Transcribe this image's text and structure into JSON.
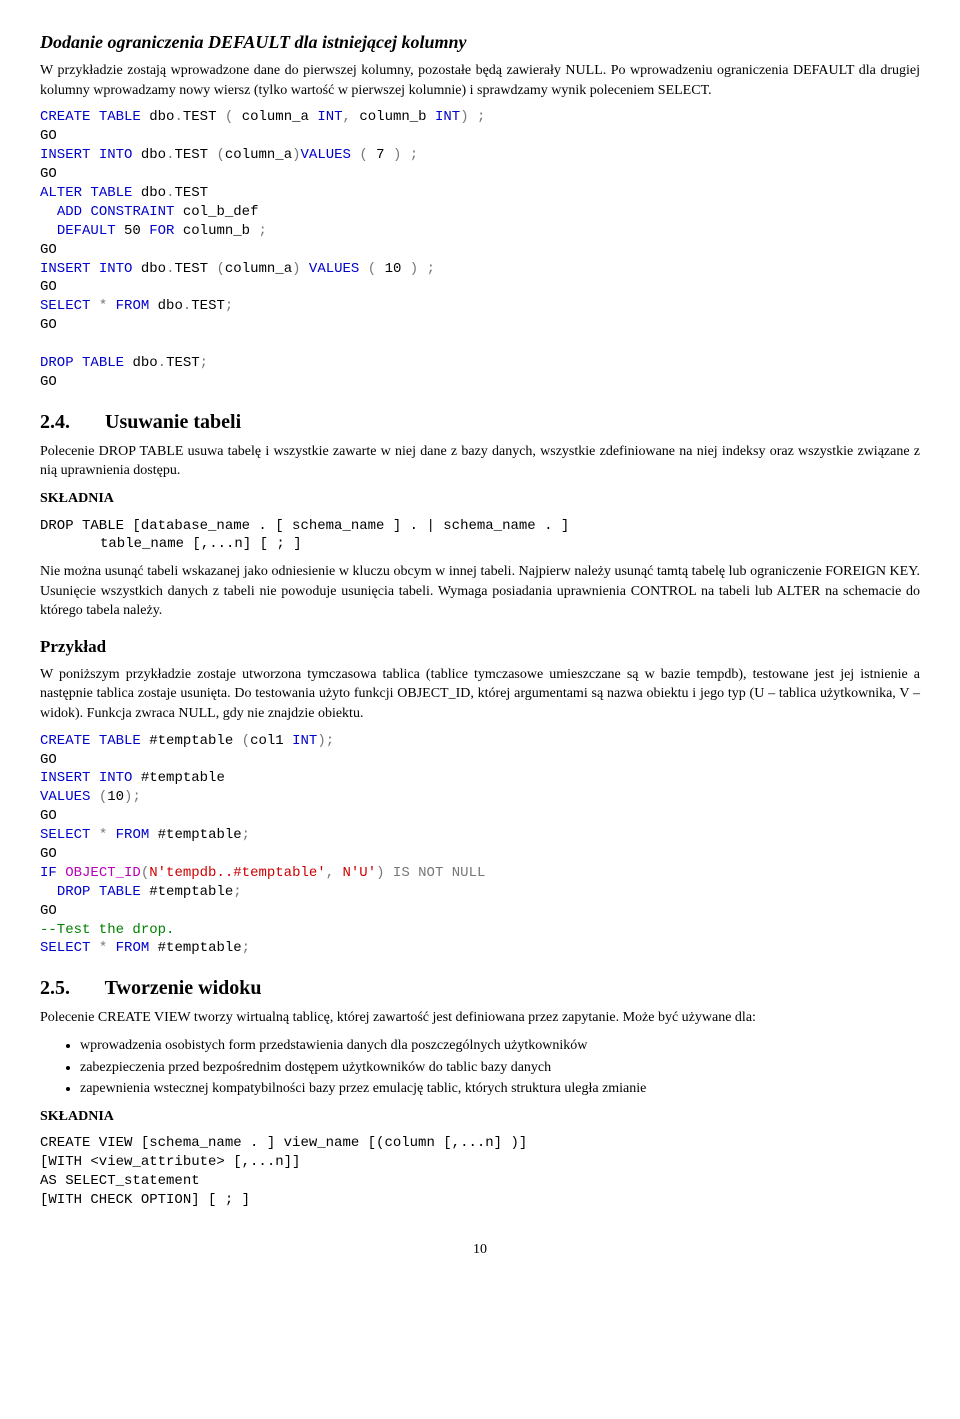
{
  "sec_default": {
    "title": "Dodanie ograniczenia DEFAULT dla istniejącej kolumny",
    "p1": "W przykładzie zostają wprowadzone dane do pierwszej kolumny, pozostałe będą zawierały NULL. Po wprowadzeniu ograniczenia DEFAULT dla drugiej kolumny wprowadzamy nowy wiersz (tylko wartość w pierwszej kolumnie) i sprawdzamy wynik poleceniem SELECT."
  },
  "code1": {
    "l1a": "CREATE",
    "l1b": "TABLE",
    "l1c": "dbo",
    "l1d": ".",
    "l1e": "TEST",
    "l1f": "(",
    "l1g": "column_a",
    "l1h": "INT",
    "l1i": ",",
    "l1j": "column_b",
    "l1k": "INT",
    "l1l": ")",
    "l1m": ";",
    "go": "GO",
    "l2a": "INSERT",
    "l2b": "INTO",
    "l2c": "dbo",
    "l2d": ".",
    "l2e": "TEST",
    "l2f": "(",
    "l2g": "column_a",
    "l2h": ")",
    "l2i": "VALUES",
    "l2j": "(",
    "l2k": "7",
    "l2l": ")",
    "l2m": ";",
    "l3a": "ALTER",
    "l3b": "TABLE",
    "l3c": "dbo",
    "l3d": ".",
    "l3e": "TEST",
    "l4a": "ADD",
    "l4b": "CONSTRAINT",
    "l4c": "col_b_def",
    "l5a": "DEFAULT",
    "l5b": "50",
    "l5c": "FOR",
    "l5d": "column_b",
    "l5e": ";",
    "l6a": "INSERT",
    "l6b": "INTO",
    "l6c": "dbo",
    "l6d": ".",
    "l6e": "TEST",
    "l6f": "(",
    "l6g": "column_a",
    "l6h": ")",
    "l6i": "VALUES",
    "l6j": "(",
    "l6k": "10",
    "l6l": ")",
    "l6m": ";",
    "l7a": "SELECT",
    "l7b": "*",
    "l7c": "FROM",
    "l7d": "dbo",
    "l7e": ".",
    "l7f": "TEST",
    "l7g": ";",
    "l8a": "DROP",
    "l8b": "TABLE",
    "l8c": "dbo",
    "l8d": ".",
    "l8e": "TEST",
    "l8f": ";"
  },
  "sec_24": {
    "num": "2.4.",
    "title": "Usuwanie tabeli",
    "p1": "Polecenie DROP TABLE usuwa tabelę i wszystkie zawarte w niej dane z bazy danych, wszystkie zdefiniowane na niej indeksy oraz wszystkie związane z nią uprawnienia dostępu.",
    "skladnia": "SKŁADNIA",
    "syntax_l1": "DROP TABLE [database_name . [ schema_name ] . | schema_name . ]",
    "syntax_l2": "table_name [,...n] [ ; ]",
    "p2": "Nie można usunąć tabeli wskazanej jako odniesienie w kluczu obcym w innej tabeli. Najpierw należy usunąć tamtą tabelę lub ograniczenie FOREIGN KEY. Usunięcie wszystkich danych z tabeli nie powoduje usunięcia tabeli. Wymaga posiadania uprawnienia CONTROL na tabeli lub ALTER na schemacie do którego tabela należy."
  },
  "przyklad": {
    "title": "Przykład",
    "p1": "W poniższym przykładzie zostaje utworzona tymczasowa tablica (tablice tymczasowe umieszczane są w bazie tempdb), testowane jest jej istnienie a następnie tablica zostaje usunięta. Do testowania użyto funkcji OBJECT_ID, której argumentami są nazwa obiektu i jego typ (U – tablica użytkownika, V – widok). Funkcja zwraca NULL, gdy nie znajdzie obiektu."
  },
  "code2": {
    "l1a": "CREATE",
    "l1b": "TABLE",
    "l1c": "#temptable",
    "l1d": "(",
    "l1e": "col1",
    "l1f": "INT",
    "l1g": ");",
    "go": "GO",
    "l2a": "INSERT",
    "l2b": "INTO",
    "l2c": "#temptable",
    "l3a": "VALUES",
    "l3b": "(",
    "l3c": "10",
    "l3d": ");",
    "l4a": "SELECT",
    "l4b": "*",
    "l4c": "FROM",
    "l4d": "#temptable",
    "l4e": ";",
    "l5a": "IF",
    "l5b": "OBJECT_ID",
    "l5c": "(",
    "l5d": "N'tempdb..#temptable'",
    "l5e": ",",
    "l5f": "N'U'",
    "l5g": ")",
    "l5h": "IS",
    "l5i": "NOT",
    "l5j": "NULL",
    "l6a": "DROP",
    "l6b": "TABLE",
    "l6c": "#temptable",
    "l6d": ";",
    "l7a": "--Test the drop.",
    "l8a": "SELECT",
    "l8b": "*",
    "l8c": "FROM",
    "l8d": "#temptable",
    "l8e": ";"
  },
  "sec_25": {
    "num": "2.5.",
    "title": "Tworzenie widoku",
    "p1": "Polecenie CREATE VIEW tworzy wirtualną tablicę, której zawartość jest definiowana przez zapytanie. Może być używane dla:",
    "bullets": [
      "wprowadzenia osobistych form przedstawienia danych dla poszczególnych użytkowników",
      "zabezpieczenia przed bezpośrednim dostępem użytkowników do tablic bazy danych",
      "zapewnienia wstecznej kompatybilności bazy przez emulację tablic, których struktura uległa zmianie"
    ],
    "skladnia": "SKŁADNIA",
    "syntax_l1": "CREATE VIEW [schema_name . ] view_name [(column [,...n] )]",
    "syntax_l2": "[WITH <view_attribute> [,...n]]",
    "syntax_l3": "AS SELECT_statement",
    "syntax_l4": "[WITH CHECK OPTION] [ ; ]"
  },
  "page_number": "10"
}
